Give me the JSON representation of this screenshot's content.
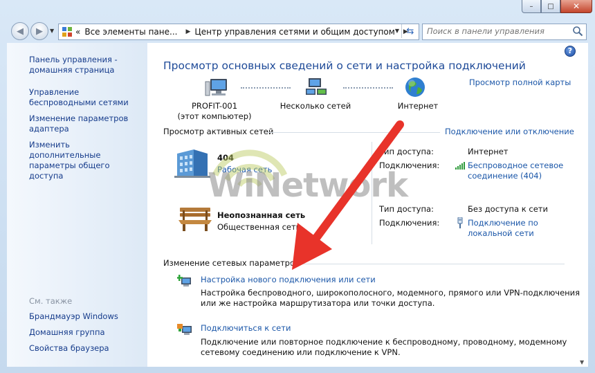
{
  "window": {
    "controls": {
      "minimize": "–",
      "maximize": "□",
      "close": "✕"
    }
  },
  "nav": {
    "back_icon": "back-arrow-icon",
    "forward_icon": "forward-arrow-icon",
    "breadcrumbs": [
      "Все элементы пане...",
      "Центр управления сетями и общим доступом"
    ],
    "separator": "▶",
    "search_placeholder": "Поиск в панели управления"
  },
  "sidebar": {
    "items": [
      "Панель управления - домашняя страница",
      "Управление беспроводными сетями",
      "Изменение параметров адаптера",
      "Изменить дополнительные параметры общего доступа"
    ],
    "see_also_title": "См. также",
    "see_also": [
      "Брандмауэр Windows",
      "Домашняя группа",
      "Свойства браузера"
    ]
  },
  "main": {
    "title": "Просмотр основных сведений о сети и настройка подключений",
    "full_map_link": "Просмотр полной карты",
    "map": [
      {
        "label": "PROFIT-001",
        "sub": "(этот компьютер)",
        "icon": "computer-icon"
      },
      {
        "label": "Несколько сетей",
        "sub": "",
        "icon": "multiple-networks-icon"
      },
      {
        "label": "Интернет",
        "sub": "",
        "icon": "globe-icon"
      }
    ],
    "active_networks_title": "Просмотр активных сетей",
    "connect_disconnect_link": "Подключение или отключение",
    "networks": [
      {
        "name": "404",
        "type": "Рабочая сеть",
        "type_is_link": true,
        "icon": "work-network-building-icon",
        "access_label": "Тип доступа:",
        "access_value": "Интернет",
        "connections_label": "Подключения:",
        "connection": "Беспроводное сетевое соединение (404)",
        "connection_line1": "Беспроводное сетевое",
        "connection_line2": "соединение (404)",
        "connection_icon": "wireless-signal-icon"
      },
      {
        "name": "Неопознанная сеть",
        "type": "Общественная сеть",
        "type_is_link": false,
        "icon": "public-network-bench-icon",
        "access_label": "Тип доступа:",
        "access_value": "Без доступа к сети",
        "connections_label": "Подключения:",
        "connection": "Подключение по локальной сети",
        "connection_line1": "Подключение по",
        "connection_line2": "локальной сети",
        "connection_icon": "ethernet-plug-icon"
      }
    ],
    "change_settings_title": "Изменение сетевых параметров",
    "tasks": [
      {
        "link": "Настройка нового подключения или сети",
        "desc1": "Настройка беспроводного, широкополосного, модемного, прямого или VPN-подключения",
        "desc2": "или же настройка маршрутизатора или точки доступа.",
        "icon": "new-connection-icon"
      },
      {
        "link": "Подключиться к сети",
        "desc1": "Подключение или повторное подключение к беспроводному, проводному, модемному",
        "desc2": "сетевому соединению или подключение к VPN.",
        "icon": "connect-to-network-icon"
      }
    ]
  },
  "watermark": "WiNetwork",
  "colors": {
    "link": "#1a56a8",
    "title": "#1e4a98",
    "annotation_arrow": "#e8332a"
  }
}
